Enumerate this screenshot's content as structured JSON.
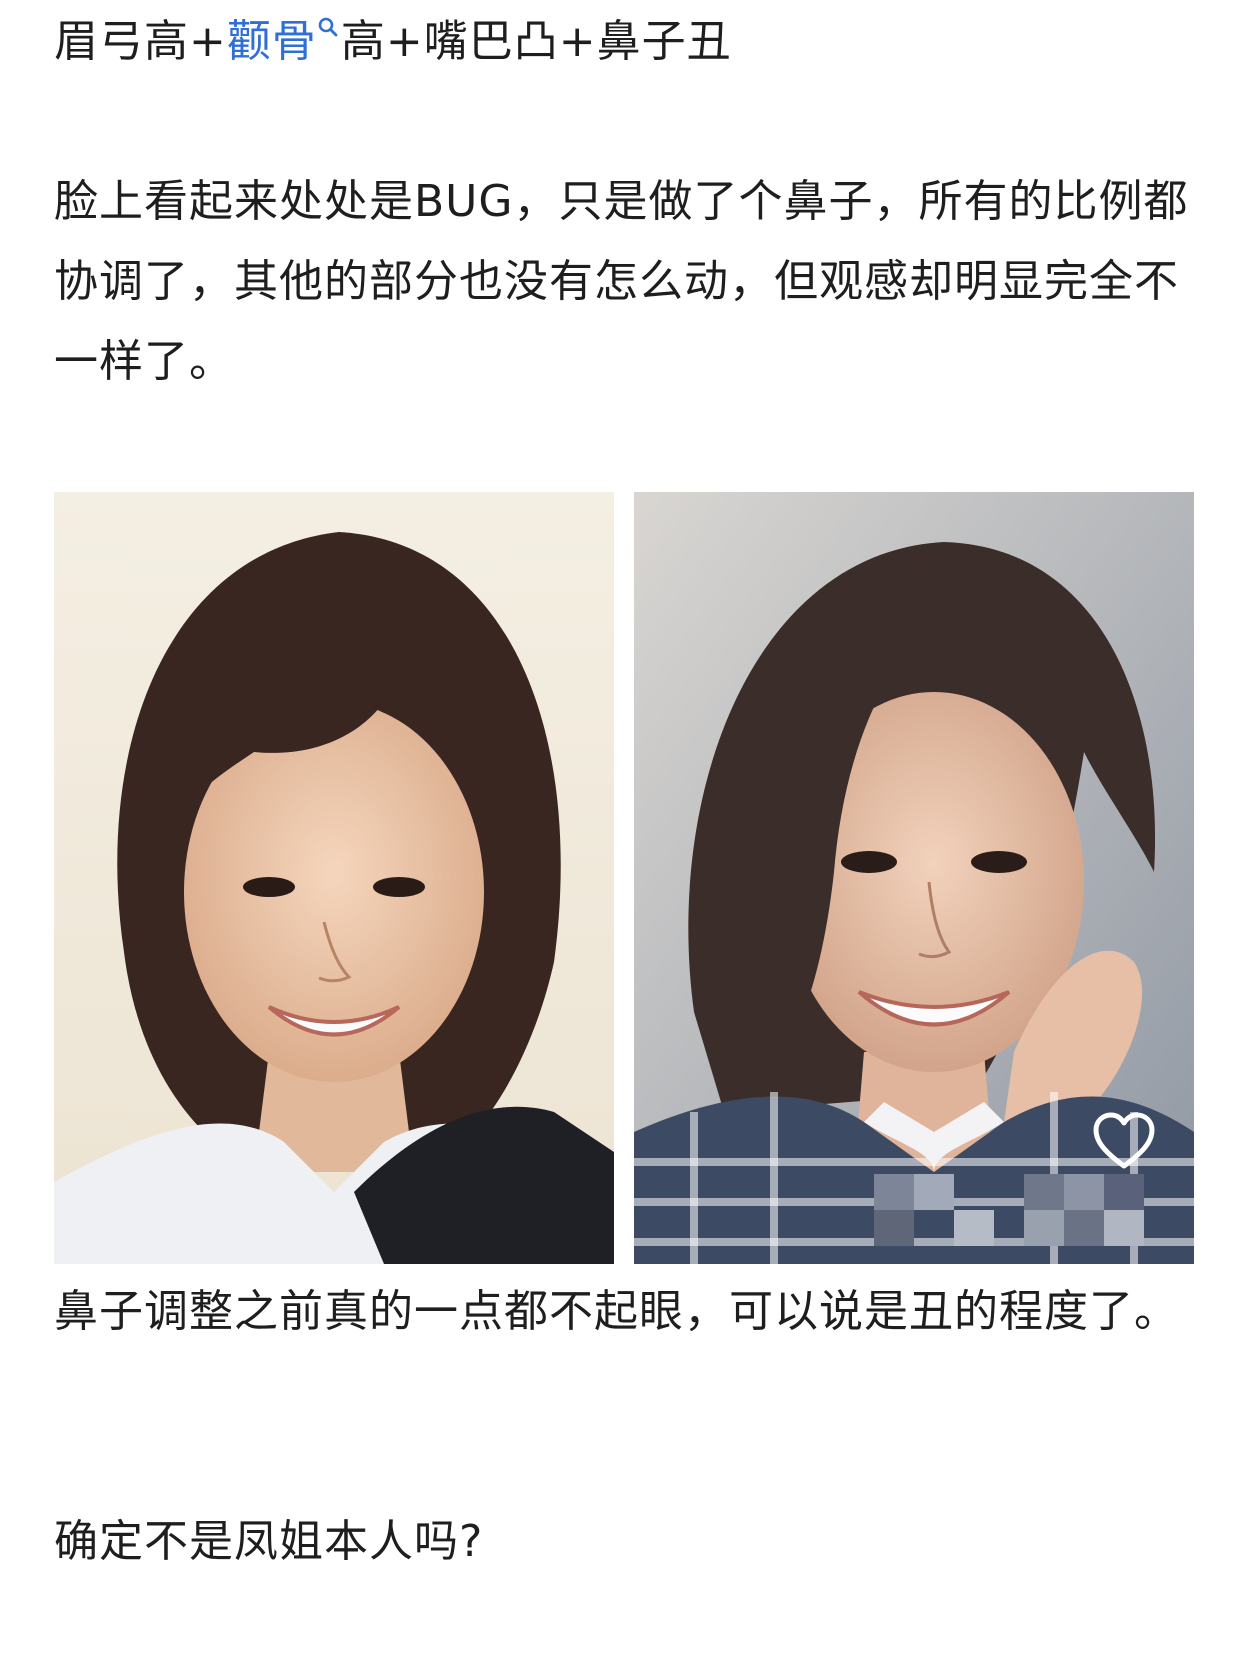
{
  "headline": {
    "part1": "眉弓高+",
    "link_keyword": "颧骨",
    "part2": "高+嘴巴凸+鼻子丑"
  },
  "paragraphs": {
    "p1": "脸上看起来处处是BUG，只是做了个鼻子，所有的比例都协调了，其他的部分也没有怎么动，但观感却明显完全不一样了。",
    "p2": "鼻子调整之前真的一点都不起眼，可以说是丑的程度了。",
    "p3": "确定不是凤姐本人吗?"
  },
  "icons": {
    "link_search": "search-icon",
    "like": "heart-outline-icon"
  },
  "colors": {
    "text": "#1e1e1e",
    "link": "#2f6fd6",
    "background": "#ffffff"
  }
}
